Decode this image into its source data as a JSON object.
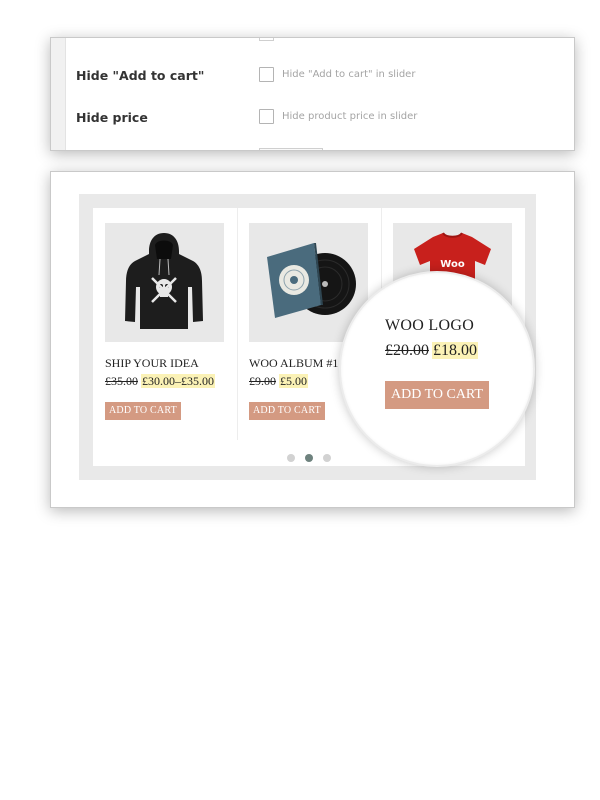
{
  "settings": {
    "rows": [
      {
        "label": "Hide \"Add to cart\"",
        "description": "Hide \"Add to cart\" in slider",
        "checked": false
      },
      {
        "label": "Hide price",
        "description": "Hide product price in slider",
        "checked": false
      }
    ]
  },
  "slider": {
    "products": [
      {
        "title": "SHIP YOUR IDEA",
        "old_price": "£35.00",
        "new_price": "£30.00–£35.00",
        "button": "ADD TO CART",
        "image_icon": "black-hoodie-icon"
      },
      {
        "title": "WOO ALBUM #1",
        "old_price": "£9.00",
        "new_price": "£5.00",
        "button": "ADD TO CART",
        "image_icon": "vinyl-album-icon"
      },
      {
        "title": "WOO LOGO",
        "old_price": "£20.00",
        "new_price": "£18.00",
        "button": "ADD TO CART",
        "image_icon": "red-tshirt-icon",
        "logo_text": "Woo"
      }
    ],
    "pagination": {
      "count": 3,
      "active_index": 1
    }
  },
  "magnifier": {
    "title": "WOO LOGO",
    "old_price": "£20.00",
    "new_price": "£18.00",
    "button": "ADD TO CART"
  },
  "colors": {
    "button": "#d49a82",
    "price_highlight": "#fbf2b6",
    "active_dot": "#6e827e",
    "inactive_dot": "#d2d2d2",
    "tshirt": "#c8201c"
  }
}
